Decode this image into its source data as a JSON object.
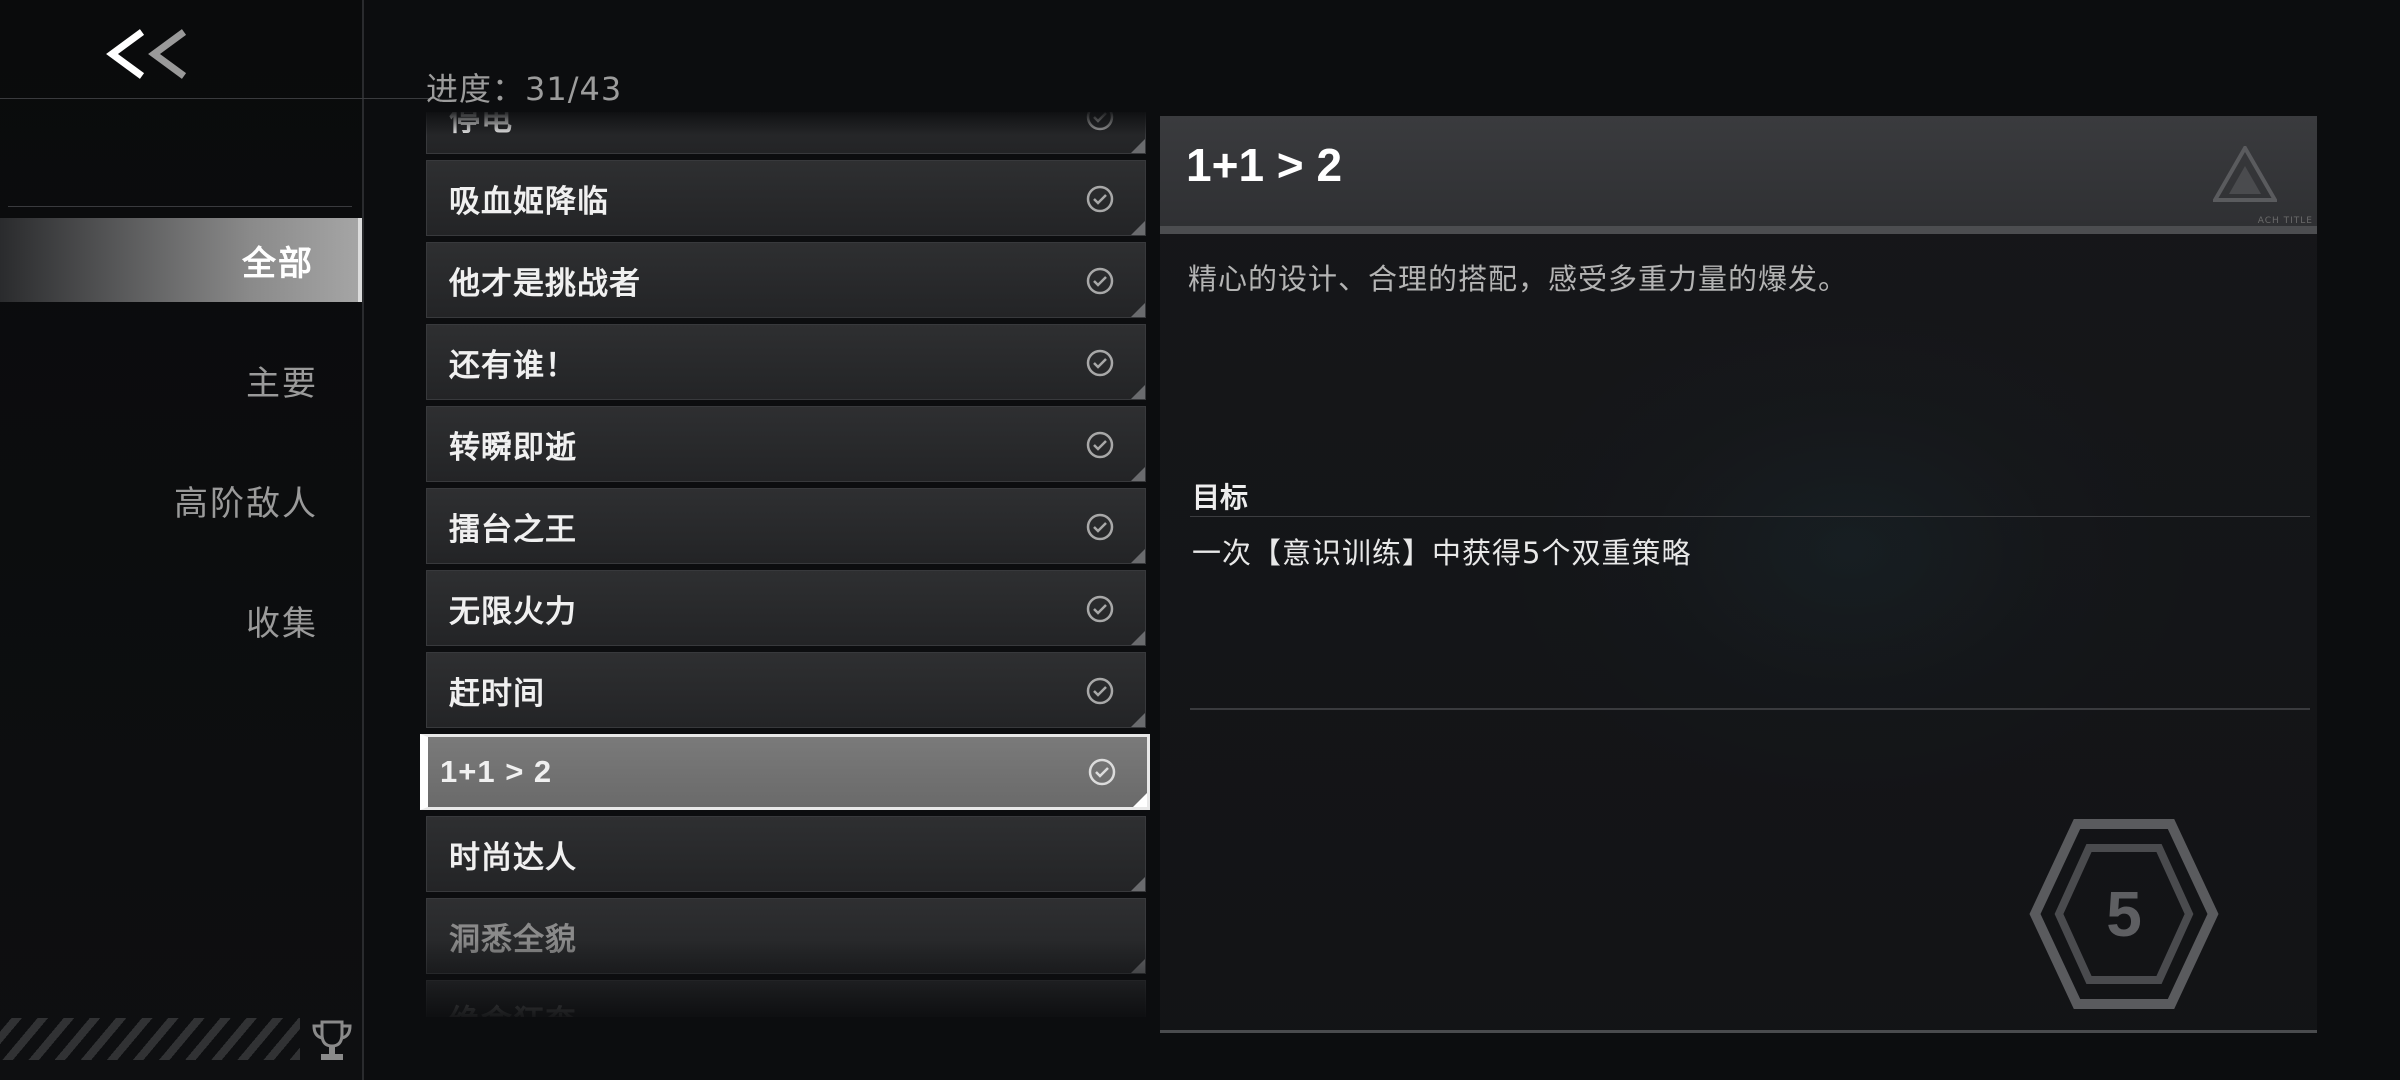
{
  "nav": {
    "back_glyph": "<<",
    "items": [
      {
        "label": "全部",
        "active": true
      },
      {
        "label": "主要",
        "active": false
      },
      {
        "label": "高阶敌人",
        "active": false
      },
      {
        "label": "收集",
        "active": false
      }
    ]
  },
  "progress": {
    "text": "进度：31/43"
  },
  "list": {
    "items": [
      {
        "label": "停电",
        "completed": true
      },
      {
        "label": "吸血姬降临",
        "completed": true
      },
      {
        "label": "他才是挑战者",
        "completed": true
      },
      {
        "label": "还有谁！",
        "completed": true
      },
      {
        "label": "转瞬即逝",
        "completed": true
      },
      {
        "label": "擂台之王",
        "completed": true
      },
      {
        "label": "无限火力",
        "completed": true
      },
      {
        "label": "赶时间",
        "completed": true
      },
      {
        "label": "1+1 > 2",
        "completed": true,
        "selected": true
      },
      {
        "label": "时尚达人",
        "completed": false
      },
      {
        "label": "洞悉全貌",
        "completed": false
      },
      {
        "label": "绝命狂奔",
        "completed": false
      }
    ]
  },
  "detail": {
    "title": "1+1 > 2",
    "header_small": "ACH TITLE",
    "description": "精心的设计、合理的搭配，感受多重力量的爆发。",
    "goal_heading": "目标",
    "goal_text": "一次【意识训练】中获得5个双重策略",
    "badge_number": "5"
  },
  "colors": {
    "accent": "#ffffff",
    "muted": "#9a9a9a",
    "panel": "#2f3033"
  }
}
